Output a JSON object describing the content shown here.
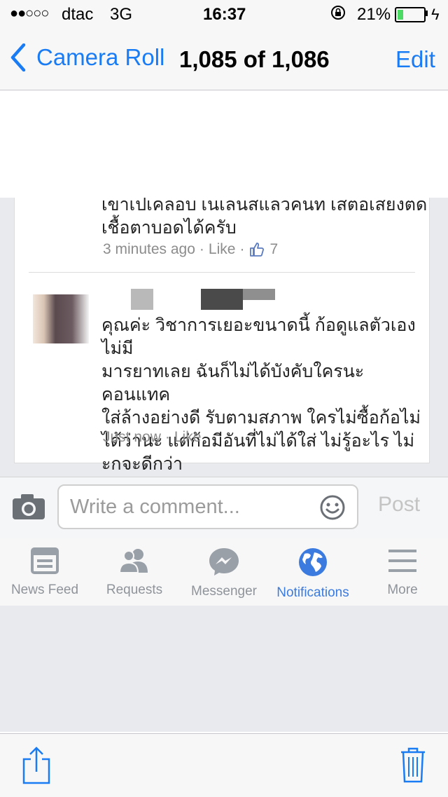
{
  "status_bar": {
    "signal": "●●○○○",
    "carrier": "dtac",
    "network": "3G",
    "time": "16:37",
    "battery_percent": "21%",
    "battery_level": 0.21,
    "battery_color": "#4cd964"
  },
  "nav": {
    "back_label": "Camera Roll",
    "title": "1,085 of 1,086",
    "edit_label": "Edit",
    "accent": "#1a7cf5"
  },
  "comments": [
    {
      "lines": [
        "เขาเปเคลอบ เนเลนสแลวคนท เสตอเสยงตด",
        "เชื้อตาบอดได้ครับ"
      ],
      "time": "3 minutes ago",
      "like_label": "Like",
      "likes": "7"
    },
    {
      "lines": [
        "คุณค่ะ วิชาการเยอะขนาดนี้ ก้อดูแลตัวเอง ไม่มี",
        "มารยาทเลย ฉันก็ไม่ได้บังคับใครนะ คอนแทค",
        "ใส่ล้างอย่างดี รับตามสภาพ ใครไม่ซื้อก้อไม่",
        "ได้ว่านะ แต่ก้อมีอันที่ไม่ได้ใส่ ไม่รู้อะไร ไม่",
        "ะกจะดีกว่า"
      ],
      "time": "Just now",
      "like_label": "Like"
    }
  ],
  "composer": {
    "placeholder": "Write a comment...",
    "post_label": "Post"
  },
  "fb_tabs": [
    {
      "label": "News Feed",
      "icon": "news-feed-icon"
    },
    {
      "label": "Requests",
      "icon": "friend-requests-icon"
    },
    {
      "label": "Messenger",
      "icon": "messenger-icon"
    },
    {
      "label": "Notifications",
      "icon": "globe-icon",
      "active": true
    },
    {
      "label": "More",
      "icon": "menu-icon"
    }
  ],
  "toolbar": {
    "share_icon": "share-icon",
    "delete_icon": "trash-icon"
  }
}
